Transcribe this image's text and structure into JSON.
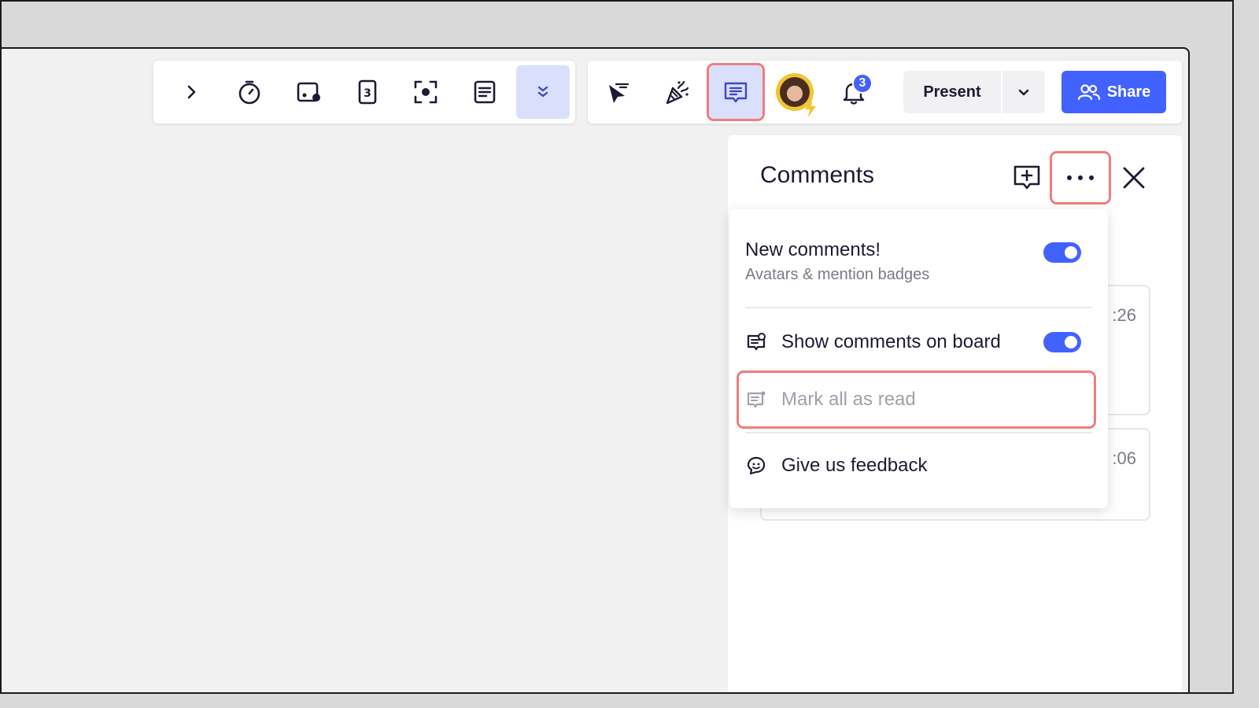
{
  "toolbar_left": {
    "items": [
      {
        "name": "expand-chevron-icon"
      },
      {
        "name": "timer-icon"
      },
      {
        "name": "voting-icon"
      },
      {
        "name": "countdown-card-icon"
      },
      {
        "name": "focus-icon"
      },
      {
        "name": "notes-icon"
      },
      {
        "name": "more-chevron-icon"
      }
    ]
  },
  "toolbar_right": {
    "bell_badge": "3",
    "present_label": "Present",
    "share_label": "Share"
  },
  "panel": {
    "title": "Comments",
    "cards": [
      {
        "time": ":26"
      },
      {
        "time": ":06"
      }
    ]
  },
  "menu": {
    "new_comments_title": "New comments!",
    "new_comments_sub": "Avatars & mention badges",
    "show_comments_label": "Show comments on board",
    "mark_read_label": "Mark all as read",
    "feedback_label": "Give us feedback"
  },
  "colors": {
    "accent": "#4262ff",
    "highlight": "#f27c7c",
    "active_tool_bg": "#dadffb"
  }
}
